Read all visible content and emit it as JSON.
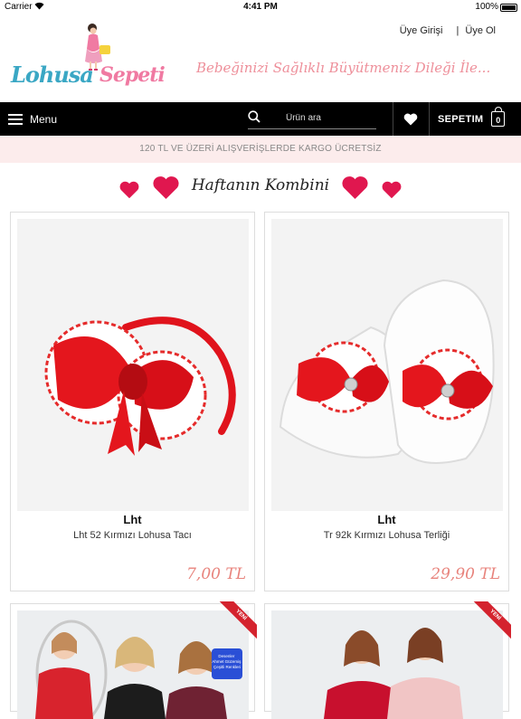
{
  "status_bar": {
    "carrier": "Carrier",
    "time": "4:41 PM",
    "battery": "100%"
  },
  "header": {
    "logo_part1": "Lohusa",
    "logo_part2": "Sepeti",
    "tagline": "Bebeğinizi Sağlıklı Büyütmeniz Dileği İle...",
    "login": "Üye Girişi",
    "separator": "|",
    "register": "Üye Ol"
  },
  "navbar": {
    "menu_label": "Menu",
    "search_placeholder": "Ürün ara",
    "cart_label": "SEPETIM",
    "cart_count": "0"
  },
  "shipping_notice": "120 TL VE ÜZERİ ALIŞVERİŞLERDE KARGO ÜCRETSİZ",
  "section": {
    "title": "Haftanın Kombini"
  },
  "products": [
    {
      "brand": "Lht",
      "name": "Lht 52 Kırmızı Lohusa Tacı",
      "price": "7,00 TL"
    },
    {
      "brand": "Lht",
      "name": "Tr 92k Kırmızı Lohusa Terliği",
      "price": "29,90 TL"
    }
  ],
  "preview_cards": [
    {
      "ribbon": "YENİ",
      "sticker": "Desenler Ahmet Güzemiş Çeşitli Renkleri Bebeni Boyamaktadır"
    },
    {
      "ribbon": "YENİ"
    }
  ],
  "colors": {
    "accent_pink": "#f07aa2",
    "accent_blue": "#3aa7c4",
    "price": "#e8837c",
    "heart": "#e0174f",
    "navbar": "#000000",
    "ribbon": "#d4232e"
  }
}
